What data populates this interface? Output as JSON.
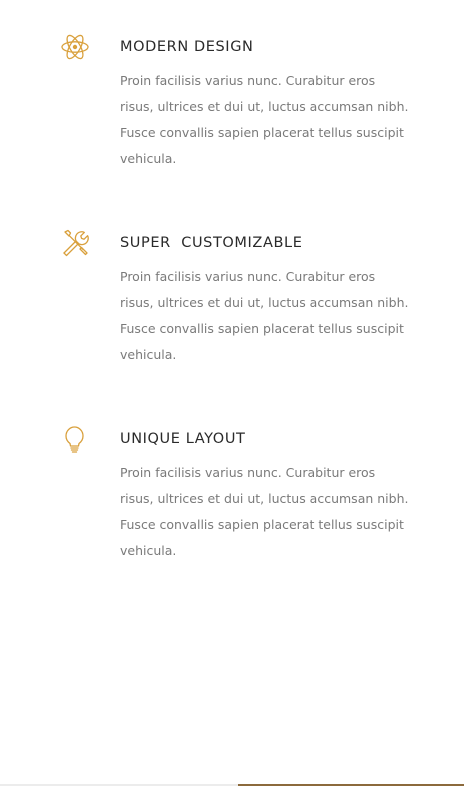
{
  "colors": {
    "icon_accent": "#d9a03c",
    "title_text": "#2a2a2a",
    "body_text": "#7a7a7a"
  },
  "features": [
    {
      "icon": "atom-icon",
      "title": "MODERN DESIGN",
      "body": "Proin facilisis varius nunc. Curabitur eros risus, ultrices et dui ut, luctus accumsan nibh. Fusce convallis sapien placerat tellus suscipit vehicula."
    },
    {
      "icon": "tools-icon",
      "title": "SUPER  CUSTOMIZABLE",
      "body": "Proin facilisis varius nunc. Curabitur eros risus, ultrices et dui ut, luctus accumsan nibh. Fusce convallis sapien placerat tellus suscipit vehicula."
    },
    {
      "icon": "lightbulb-icon",
      "title": "UNIQUE LAYOUT",
      "body": "Proin facilisis varius nunc. Curabitur eros risus, ultrices et dui ut, luctus accumsan nibh. Fusce convallis sapien placerat tellus suscipit vehicula."
    }
  ]
}
